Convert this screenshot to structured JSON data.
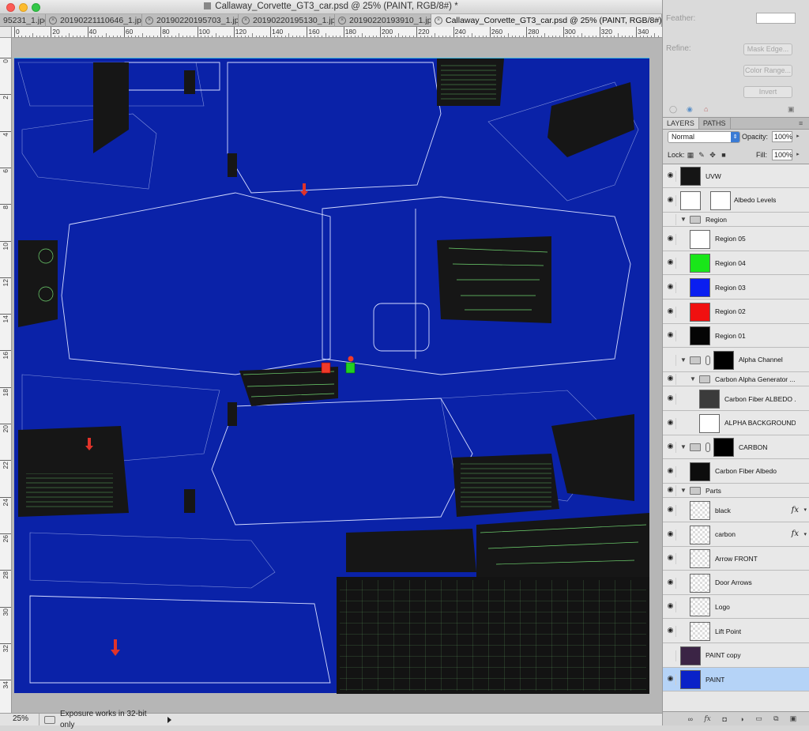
{
  "window": {
    "title": "Callaway_Corvette_GT3_car.psd @ 25% (PAINT, RGB/8#) *"
  },
  "tabs": [
    {
      "label": "95231_1.jpg",
      "close": false,
      "active": false
    },
    {
      "label": "20190221110646_1.jpg",
      "close": true,
      "active": false
    },
    {
      "label": "20190220195703_1.jpg",
      "close": true,
      "active": false
    },
    {
      "label": "20190220195130_1.jpg",
      "close": true,
      "active": false
    },
    {
      "label": "20190220193910_1.jpg",
      "close": true,
      "active": false
    },
    {
      "label": "Callaway_Corvette_GT3_car.psd @ 25% (PAINT, RGB/8#) *",
      "close": true,
      "active": true
    }
  ],
  "ruler": {
    "h_labels": [
      "0",
      "20",
      "40",
      "60",
      "80",
      "100",
      "120",
      "140",
      "160",
      "180",
      "200",
      "220",
      "240",
      "260",
      "280",
      "300",
      "320",
      "340"
    ],
    "v_labels": [
      "0",
      "2",
      "4",
      "6",
      "8",
      "10",
      "12",
      "14",
      "16",
      "18",
      "20",
      "22",
      "24",
      "26",
      "28",
      "30",
      "32",
      "34"
    ]
  },
  "status": {
    "zoom": "25%",
    "message": "Exposure works in 32-bit only"
  },
  "refine": {
    "feather_label": "Feather:",
    "refine_label": "Refine:",
    "mask_edge": "Mask Edge...",
    "color_range": "Color Range...",
    "invert": "Invert"
  },
  "panel_tabs": [
    "LAYERS",
    "PATHS"
  ],
  "blend": {
    "mode": "Normal",
    "opacity_label": "Opacity:",
    "opacity": "100%",
    "lock_label": "Lock:",
    "fill_label": "Fill:",
    "fill": "100%"
  },
  "layers": [
    {
      "name": "UVW",
      "visible": true,
      "kind": "layer",
      "indent": 0,
      "thumb": "#151515"
    },
    {
      "name": "Albedo Levels",
      "visible": true,
      "kind": "adjust",
      "indent": 0,
      "thumb": "#ffffff"
    },
    {
      "name": "Region",
      "visible": false,
      "kind": "group",
      "indent": 0
    },
    {
      "name": "Region 05",
      "visible": true,
      "kind": "layer",
      "indent": 1,
      "thumb": "#ffffff"
    },
    {
      "name": "Region 04",
      "visible": true,
      "kind": "layer",
      "indent": 1,
      "thumb": "#19e619"
    },
    {
      "name": "Region 03",
      "visible": true,
      "kind": "layer",
      "indent": 1,
      "thumb": "#0a1ef0"
    },
    {
      "name": "Region 02",
      "visible": true,
      "kind": "layer",
      "indent": 1,
      "thumb": "#f01010"
    },
    {
      "name": "Region 01",
      "visible": true,
      "kind": "layer",
      "indent": 1,
      "thumb": "#050505"
    },
    {
      "name": "Alpha Channel",
      "visible": false,
      "kind": "group-mask",
      "indent": 0
    },
    {
      "name": "Carbon Alpha Generator ...",
      "visible": true,
      "kind": "group",
      "indent": 1
    },
    {
      "name": "Carbon Fiber ALBEDO ...",
      "visible": true,
      "kind": "layer",
      "indent": 2,
      "thumb": "#3b3b3b"
    },
    {
      "name": "ALPHA BACKGROUND",
      "visible": true,
      "kind": "layer",
      "indent": 2,
      "thumb": "#ffffff"
    },
    {
      "name": "CARBON",
      "visible": true,
      "kind": "group-mask",
      "indent": 0
    },
    {
      "name": "Carbon Fiber Albedo",
      "visible": true,
      "kind": "layer",
      "indent": 1,
      "thumb": "#0d0d0d"
    },
    {
      "name": "Parts",
      "visible": true,
      "kind": "group",
      "indent": 0
    },
    {
      "name": "black",
      "visible": true,
      "kind": "layer-fx",
      "indent": 1,
      "thumb": "checker"
    },
    {
      "name": "carbon",
      "visible": true,
      "kind": "layer-fx",
      "indent": 1,
      "thumb": "checker"
    },
    {
      "name": "Arrow FRONT",
      "visible": true,
      "kind": "layer",
      "indent": 1,
      "thumb": "checker"
    },
    {
      "name": "Door Arrows",
      "visible": true,
      "kind": "layer",
      "indent": 1,
      "thumb": "checker"
    },
    {
      "name": "Logo",
      "visible": true,
      "kind": "layer",
      "indent": 1,
      "thumb": "checker"
    },
    {
      "name": "Lift Point",
      "visible": true,
      "kind": "layer",
      "indent": 1,
      "thumb": "checker"
    },
    {
      "name": "PAINT copy",
      "visible": false,
      "kind": "layer",
      "indent": 0,
      "thumb": "#3b2445"
    },
    {
      "name": "PAINT",
      "visible": true,
      "kind": "layer",
      "indent": 0,
      "thumb": "#0a22c8",
      "selected": true
    }
  ],
  "colors": {
    "paint": "#0a22a8",
    "selection": "#b5d3f7",
    "accent": "#3a7bd5"
  }
}
